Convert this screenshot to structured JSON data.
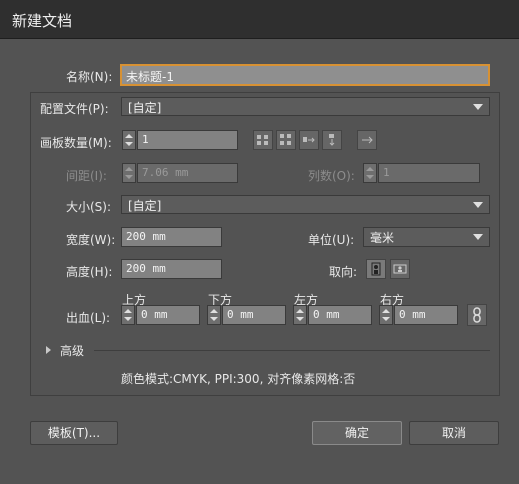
{
  "window": {
    "title": "新建文档"
  },
  "name": {
    "label": "名称(N):",
    "value": "未标题-1"
  },
  "profile": {
    "label": "配置文件(P):",
    "value": "[自定]"
  },
  "artboards": {
    "count_label": "画板数量(M):",
    "count_value": "1"
  },
  "spacing": {
    "label": "间距(I):",
    "value": "7.06 mm",
    "columns_label": "列数(O):",
    "columns_value": "1"
  },
  "size": {
    "label": "大小(S):",
    "value": "[自定]"
  },
  "width": {
    "label": "宽度(W):",
    "value": "200 mm"
  },
  "units": {
    "label": "单位(U):",
    "value": "毫米"
  },
  "height": {
    "label": "高度(H):",
    "value": "200 mm"
  },
  "orientation": {
    "label": "取向:"
  },
  "bleed": {
    "label": "出血(L):",
    "top_label": "上方",
    "top_value": "0 mm",
    "bottom_label": "下方",
    "bottom_value": "0 mm",
    "left_label": "左方",
    "left_value": "0 mm",
    "right_label": "右方",
    "right_value": "0 mm"
  },
  "advanced": {
    "label": "高级",
    "summary": "颜色模式:CMYK, PPI:300, 对齐像素网格:否"
  },
  "buttons": {
    "templates": "模板(T)...",
    "ok": "确定",
    "cancel": "取消"
  },
  "icons": {
    "arrange": [
      "grid-by-row-icon",
      "grid-by-column-icon",
      "arrange-by-row-icon",
      "arrange-by-column-icon",
      "right-to-left-icon"
    ],
    "orientation": [
      "portrait-icon",
      "landscape-icon"
    ],
    "link": "link-icon"
  },
  "colors": {
    "focus": "#d79133",
    "background": "#535353",
    "titlebar": "#2f2f2f"
  }
}
